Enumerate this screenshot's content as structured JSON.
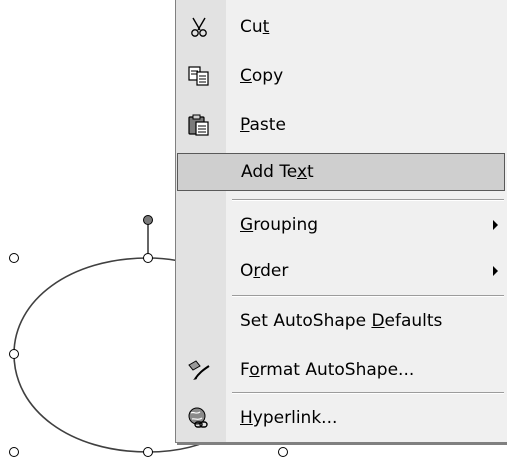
{
  "menu": {
    "items": [
      {
        "label": "Cut",
        "underline": "t",
        "icon": "scissors-icon",
        "highlighted": false,
        "submenu": false
      },
      {
        "label": "Copy",
        "underline": "C",
        "icon": "copy-icon",
        "highlighted": false,
        "submenu": false
      },
      {
        "label": "Paste",
        "underline": "P",
        "icon": "paste-icon",
        "highlighted": false,
        "submenu": false
      },
      {
        "label": "Add Text",
        "underline": "x",
        "icon": "",
        "highlighted": true,
        "submenu": false
      },
      {
        "label": "Grouping",
        "underline": "G",
        "icon": "",
        "highlighted": false,
        "submenu": true
      },
      {
        "label": "Order",
        "underline": "r",
        "icon": "",
        "highlighted": false,
        "submenu": true
      },
      {
        "label": "Set AutoShape Defaults",
        "underline": "D",
        "icon": "",
        "highlighted": false,
        "submenu": false
      },
      {
        "label": "Format AutoShape...",
        "underline": "o",
        "icon": "format-autoshape-icon",
        "highlighted": false,
        "submenu": false
      },
      {
        "label": "Hyperlink...",
        "underline": "H",
        "icon": "hyperlink-globe-icon",
        "highlighted": false,
        "submenu": false
      }
    ]
  },
  "colors": {
    "menu_bg": "#f0f0f0",
    "gutter": "#e2e2e2",
    "highlight": "#cfcfcf",
    "shape_stroke": "#404040"
  }
}
